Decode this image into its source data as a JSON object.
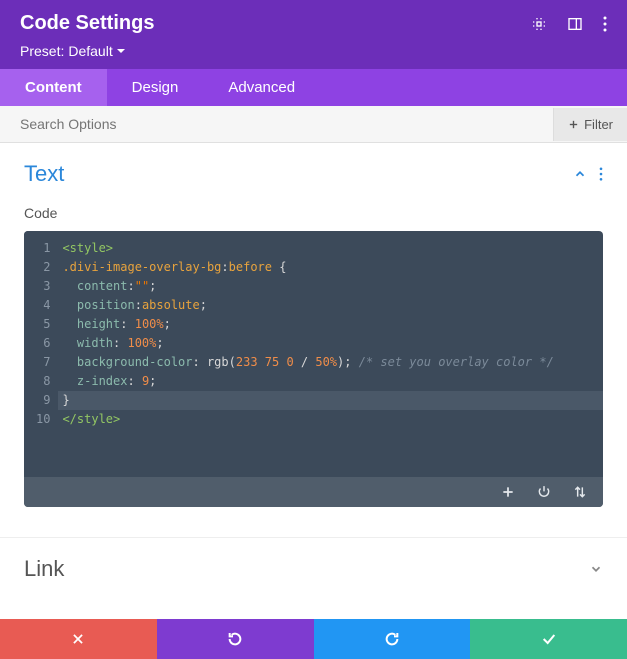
{
  "header": {
    "title": "Code Settings",
    "preset_label": "Preset:",
    "preset_value": "Default"
  },
  "tabs": {
    "content": "Content",
    "design": "Design",
    "advanced": "Advanced"
  },
  "search": {
    "placeholder": "Search Options",
    "filter_label": "Filter"
  },
  "sections": {
    "text": {
      "title": "Text",
      "field_label": "Code"
    },
    "link": {
      "title": "Link"
    }
  },
  "code": {
    "lines": [
      {
        "n": "1",
        "parts": [
          {
            "c": "t-tag",
            "t": "<style>"
          }
        ]
      },
      {
        "n": "2",
        "parts": [
          {
            "c": "t-sel",
            "t": ".divi-image-overlay-bg"
          },
          {
            "c": "t-punc",
            "t": ":"
          },
          {
            "c": "t-kw",
            "t": "before"
          },
          {
            "c": "t-punc",
            "t": " {"
          }
        ]
      },
      {
        "n": "3",
        "parts": [
          {
            "c": "",
            "t": "  "
          },
          {
            "c": "t-prop",
            "t": "content"
          },
          {
            "c": "t-punc",
            "t": ":"
          },
          {
            "c": "t-str",
            "t": "\"\""
          },
          {
            "c": "t-punc",
            "t": ";"
          }
        ]
      },
      {
        "n": "4",
        "parts": [
          {
            "c": "",
            "t": "  "
          },
          {
            "c": "t-prop",
            "t": "position"
          },
          {
            "c": "t-punc",
            "t": ":"
          },
          {
            "c": "t-kw",
            "t": "absolute"
          },
          {
            "c": "t-punc",
            "t": ";"
          }
        ]
      },
      {
        "n": "5",
        "parts": [
          {
            "c": "",
            "t": "  "
          },
          {
            "c": "t-prop",
            "t": "height"
          },
          {
            "c": "t-punc",
            "t": ": "
          },
          {
            "c": "t-pct",
            "t": "100%"
          },
          {
            "c": "t-punc",
            "t": ";"
          }
        ]
      },
      {
        "n": "6",
        "parts": [
          {
            "c": "",
            "t": "  "
          },
          {
            "c": "t-prop",
            "t": "width"
          },
          {
            "c": "t-punc",
            "t": ": "
          },
          {
            "c": "t-pct",
            "t": "100%"
          },
          {
            "c": "t-punc",
            "t": ";"
          }
        ]
      },
      {
        "n": "7",
        "parts": [
          {
            "c": "",
            "t": "  "
          },
          {
            "c": "t-prop",
            "t": "background-color"
          },
          {
            "c": "t-punc",
            "t": ": "
          },
          {
            "c": "t-fn",
            "t": "rgb"
          },
          {
            "c": "t-punc",
            "t": "("
          },
          {
            "c": "t-num",
            "t": "233 75 0"
          },
          {
            "c": "t-punc",
            "t": " / "
          },
          {
            "c": "t-pct",
            "t": "50%"
          },
          {
            "c": "t-punc",
            "t": ");"
          },
          {
            "c": "",
            "t": " "
          },
          {
            "c": "t-cmt",
            "t": "/* set you overlay color */"
          }
        ]
      },
      {
        "n": "8",
        "parts": [
          {
            "c": "",
            "t": "  "
          },
          {
            "c": "t-prop",
            "t": "z-index"
          },
          {
            "c": "t-punc",
            "t": ": "
          },
          {
            "c": "t-num",
            "t": "9"
          },
          {
            "c": "t-punc",
            "t": ";"
          }
        ]
      },
      {
        "n": "9",
        "parts": [
          {
            "c": "t-punc",
            "t": "}"
          }
        ],
        "active": true
      },
      {
        "n": "10",
        "parts": [
          {
            "c": "t-tag",
            "t": "</style>"
          }
        ]
      }
    ]
  }
}
